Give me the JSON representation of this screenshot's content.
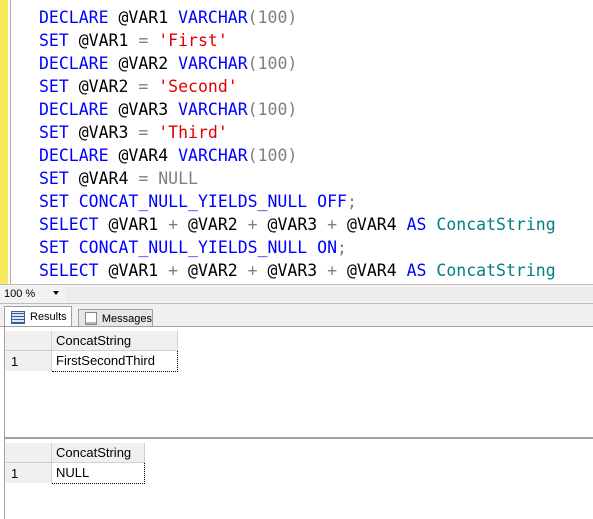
{
  "editor": {
    "lines": [
      [
        {
          "t": "DECLARE ",
          "c": "kw"
        },
        {
          "t": "@VAR1 ",
          "c": "plain"
        },
        {
          "t": "VARCHAR",
          "c": "kw"
        },
        {
          "t": "(100)",
          "c": "gray"
        }
      ],
      [
        {
          "t": "SET ",
          "c": "kw"
        },
        {
          "t": "@VAR1 ",
          "c": "plain"
        },
        {
          "t": "= ",
          "c": "gray"
        },
        {
          "t": "'First'",
          "c": "str"
        }
      ],
      [
        {
          "t": "DECLARE ",
          "c": "kw"
        },
        {
          "t": "@VAR2 ",
          "c": "plain"
        },
        {
          "t": "VARCHAR",
          "c": "kw"
        },
        {
          "t": "(100)",
          "c": "gray"
        }
      ],
      [
        {
          "t": "SET ",
          "c": "kw"
        },
        {
          "t": "@VAR2 ",
          "c": "plain"
        },
        {
          "t": "= ",
          "c": "gray"
        },
        {
          "t": "'Second'",
          "c": "str"
        }
      ],
      [
        {
          "t": "DECLARE ",
          "c": "kw"
        },
        {
          "t": "@VAR3 ",
          "c": "plain"
        },
        {
          "t": "VARCHAR",
          "c": "kw"
        },
        {
          "t": "(100)",
          "c": "gray"
        }
      ],
      [
        {
          "t": "SET ",
          "c": "kw"
        },
        {
          "t": "@VAR3 ",
          "c": "plain"
        },
        {
          "t": "= ",
          "c": "gray"
        },
        {
          "t": "'Third'",
          "c": "str"
        }
      ],
      [
        {
          "t": "DECLARE ",
          "c": "kw"
        },
        {
          "t": "@VAR4 ",
          "c": "plain"
        },
        {
          "t": "VARCHAR",
          "c": "kw"
        },
        {
          "t": "(100)",
          "c": "gray"
        }
      ],
      [
        {
          "t": "SET ",
          "c": "kw"
        },
        {
          "t": "@VAR4 ",
          "c": "plain"
        },
        {
          "t": "= ",
          "c": "gray"
        },
        {
          "t": "NULL",
          "c": "gray"
        }
      ],
      [
        {
          "t": "SET ",
          "c": "kw"
        },
        {
          "t": "CONCAT_NULL_YIELDS_NULL ",
          "c": "kw"
        },
        {
          "t": "OFF",
          "c": "kw"
        },
        {
          "t": ";",
          "c": "gray"
        }
      ],
      [
        {
          "t": "SELECT ",
          "c": "kw"
        },
        {
          "t": "@VAR1 ",
          "c": "plain"
        },
        {
          "t": "+ ",
          "c": "gray"
        },
        {
          "t": "@VAR2 ",
          "c": "plain"
        },
        {
          "t": "+ ",
          "c": "gray"
        },
        {
          "t": "@VAR3 ",
          "c": "plain"
        },
        {
          "t": "+ ",
          "c": "gray"
        },
        {
          "t": "@VAR4 ",
          "c": "plain"
        },
        {
          "t": "AS ",
          "c": "kw"
        },
        {
          "t": "ConcatString",
          "c": "fn"
        }
      ],
      [
        {
          "t": "SET ",
          "c": "kw"
        },
        {
          "t": "CONCAT_NULL_YIELDS_NULL ",
          "c": "kw"
        },
        {
          "t": "ON",
          "c": "kw"
        },
        {
          "t": ";",
          "c": "gray"
        }
      ],
      [
        {
          "t": "SELECT ",
          "c": "kw"
        },
        {
          "t": "@VAR1 ",
          "c": "plain"
        },
        {
          "t": "+ ",
          "c": "gray"
        },
        {
          "t": "@VAR2 ",
          "c": "plain"
        },
        {
          "t": "+ ",
          "c": "gray"
        },
        {
          "t": "@VAR3 ",
          "c": "plain"
        },
        {
          "t": "+ ",
          "c": "gray"
        },
        {
          "t": "@VAR4 ",
          "c": "plain"
        },
        {
          "t": "AS ",
          "c": "kw"
        },
        {
          "t": "ConcatString",
          "c": "fn"
        }
      ]
    ],
    "colors": {
      "kw": "#0000ff",
      "str": "#e00000",
      "gray": "#808080",
      "fn": "#008080",
      "plain": "#000000"
    }
  },
  "zoom": {
    "value": "100 %"
  },
  "tabs": {
    "results": "Results",
    "messages": "Messages"
  },
  "grid1": {
    "column": "ConcatString",
    "row_number": "1",
    "value": "FirstSecondThird"
  },
  "grid2": {
    "column": "ConcatString",
    "row_number": "1",
    "value": "NULL"
  }
}
